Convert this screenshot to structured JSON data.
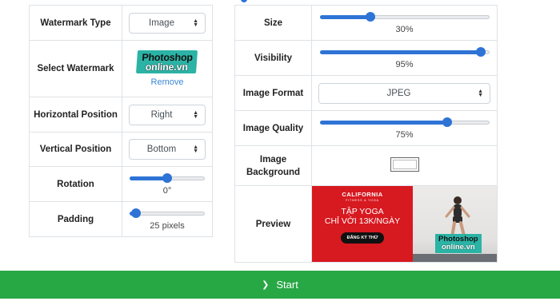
{
  "left": {
    "watermark_type": {
      "label": "Watermark Type",
      "value": "Image"
    },
    "select_watermark": {
      "label": "Select Watermark",
      "logo_line1": "Photoshop",
      "logo_line2": "online.vn",
      "remove": "Remove",
      "logo_color": "#2bb3a5"
    },
    "horizontal_position": {
      "label": "Horizontal Position",
      "value": "Right"
    },
    "vertical_position": {
      "label": "Vertical Position",
      "value": "Bottom"
    },
    "rotation": {
      "label": "Rotation",
      "value_text": "0°",
      "fraction": 0.5
    },
    "padding": {
      "label": "Padding",
      "value_text": "25 pixels",
      "fraction": 0.08
    }
  },
  "right": {
    "size": {
      "label": "Size",
      "value_text": "30%",
      "fraction": 0.3
    },
    "visibility": {
      "label": "Visibility",
      "value_text": "95%",
      "fraction": 0.95
    },
    "image_format": {
      "label": "Image Format",
      "value": "JPEG"
    },
    "image_quality": {
      "label": "Image Quality",
      "value_text": "75%",
      "fraction": 0.75
    },
    "image_background": {
      "label": "Image Background",
      "color": "#ffffff"
    },
    "preview": {
      "label": "Preview",
      "brand": "CALIFORNIA",
      "tagline": "FITNESS & YOGA",
      "headline1": "TẬP YOGA",
      "headline2": "CHỈ VỚI 13K/NGÀY",
      "cta": "ĐĂNG KÝ THỬ",
      "wm_line1": "Photoshop",
      "wm_line2": "online.vn"
    }
  },
  "start": {
    "label": "Start",
    "color": "#28a745"
  },
  "accent_color": "#2e73d6"
}
